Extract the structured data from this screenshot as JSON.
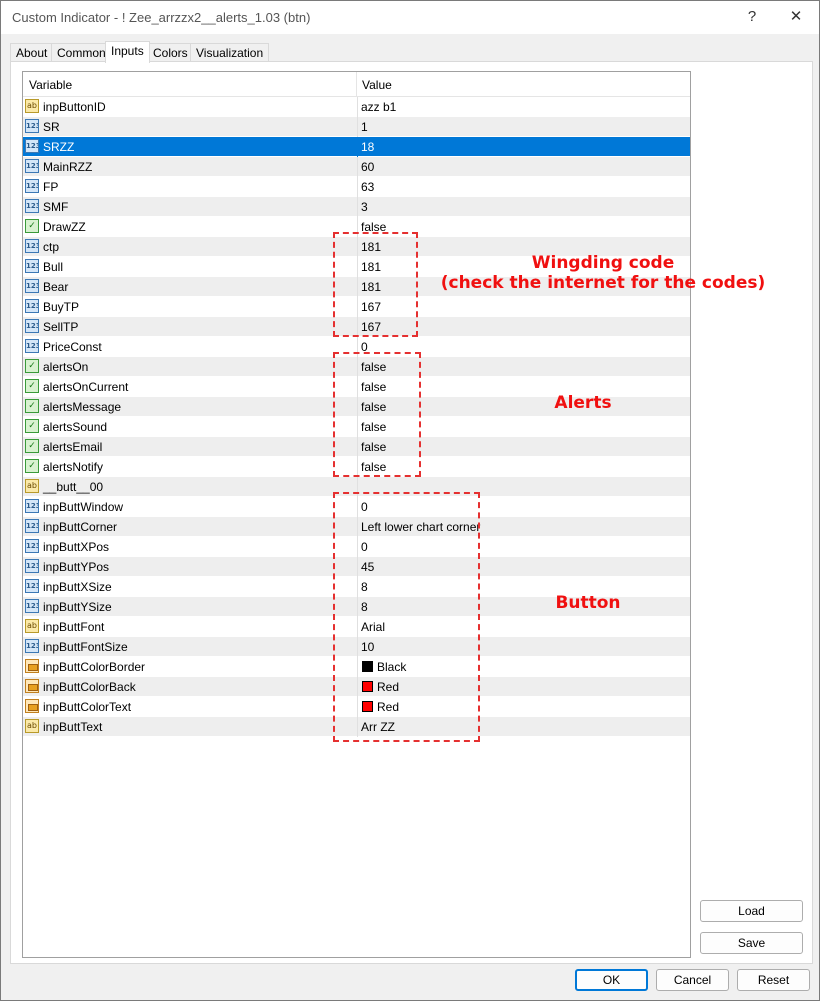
{
  "window": {
    "title": "Custom Indicator - ! Zee_arrzzx2__alerts_1.03 (btn)",
    "help_glyph": "?",
    "close_glyph": "✕"
  },
  "tabs": [
    {
      "label": "About",
      "active": false
    },
    {
      "label": "Common",
      "active": false
    },
    {
      "label": "Inputs",
      "active": true
    },
    {
      "label": "Colors",
      "active": false
    },
    {
      "label": "Visualization",
      "active": false
    }
  ],
  "grid": {
    "columns": {
      "variable": "Variable",
      "value": "Value"
    },
    "rows": [
      {
        "type": "str",
        "name": "inpButtonID",
        "value": "azz b1"
      },
      {
        "type": "num",
        "name": "SR",
        "value": "1"
      },
      {
        "type": "num",
        "name": "SRZZ",
        "value": "18",
        "selected": true
      },
      {
        "type": "num",
        "name": "MainRZZ",
        "value": "60"
      },
      {
        "type": "num",
        "name": "FP",
        "value": "63"
      },
      {
        "type": "num",
        "name": "SMF",
        "value": "3"
      },
      {
        "type": "bool",
        "name": "DrawZZ",
        "value": "false"
      },
      {
        "type": "num",
        "name": "ctp",
        "value": "181"
      },
      {
        "type": "num",
        "name": "Bull",
        "value": "181"
      },
      {
        "type": "num",
        "name": "Bear",
        "value": "181"
      },
      {
        "type": "num",
        "name": "BuyTP",
        "value": "167"
      },
      {
        "type": "num",
        "name": "SellTP",
        "value": "167"
      },
      {
        "type": "num",
        "name": "PriceConst",
        "value": "0"
      },
      {
        "type": "bool",
        "name": "alertsOn",
        "value": "false"
      },
      {
        "type": "bool",
        "name": "alertsOnCurrent",
        "value": "false"
      },
      {
        "type": "bool",
        "name": "alertsMessage",
        "value": "false"
      },
      {
        "type": "bool",
        "name": "alertsSound",
        "value": "false"
      },
      {
        "type": "bool",
        "name": "alertsEmail",
        "value": "false"
      },
      {
        "type": "bool",
        "name": "alertsNotify",
        "value": "false"
      },
      {
        "type": "str",
        "name": "__butt__00",
        "value": ""
      },
      {
        "type": "num",
        "name": "inpButtWindow",
        "value": "0"
      },
      {
        "type": "num",
        "name": "inpButtCorner",
        "value": "Left lower chart corner"
      },
      {
        "type": "num",
        "name": "inpButtXPos",
        "value": "0"
      },
      {
        "type": "num",
        "name": "inpButtYPos",
        "value": "45"
      },
      {
        "type": "num",
        "name": "inpButtXSize",
        "value": "8"
      },
      {
        "type": "num",
        "name": "inpButtYSize",
        "value": "8"
      },
      {
        "type": "str",
        "name": "inpButtFont",
        "value": "Arial"
      },
      {
        "type": "num",
        "name": "inpButtFontSize",
        "value": "10"
      },
      {
        "type": "color",
        "name": "inpButtColorBorder",
        "value": "Black",
        "swatch": "#000000"
      },
      {
        "type": "color",
        "name": "inpButtColorBack",
        "value": "Red",
        "swatch": "#ff0000"
      },
      {
        "type": "color",
        "name": "inpButtColorText",
        "value": "Red",
        "swatch": "#ff0000"
      },
      {
        "type": "str",
        "name": "inpButtText",
        "value": "Arr ZZ"
      }
    ]
  },
  "icons": {
    "num": "123",
    "str": "ab",
    "bool": "✓"
  },
  "annotations": {
    "wingding_line1": "Wingding code",
    "wingding_line2": "(check the internet for the codes)",
    "alerts": "Alerts",
    "button": "Button"
  },
  "side_buttons": {
    "load": "Load",
    "save": "Save"
  },
  "footer": {
    "ok": "OK",
    "cancel": "Cancel",
    "reset": "Reset"
  },
  "colors": {
    "selection": "#0078d7",
    "annotation": "#f01010"
  }
}
